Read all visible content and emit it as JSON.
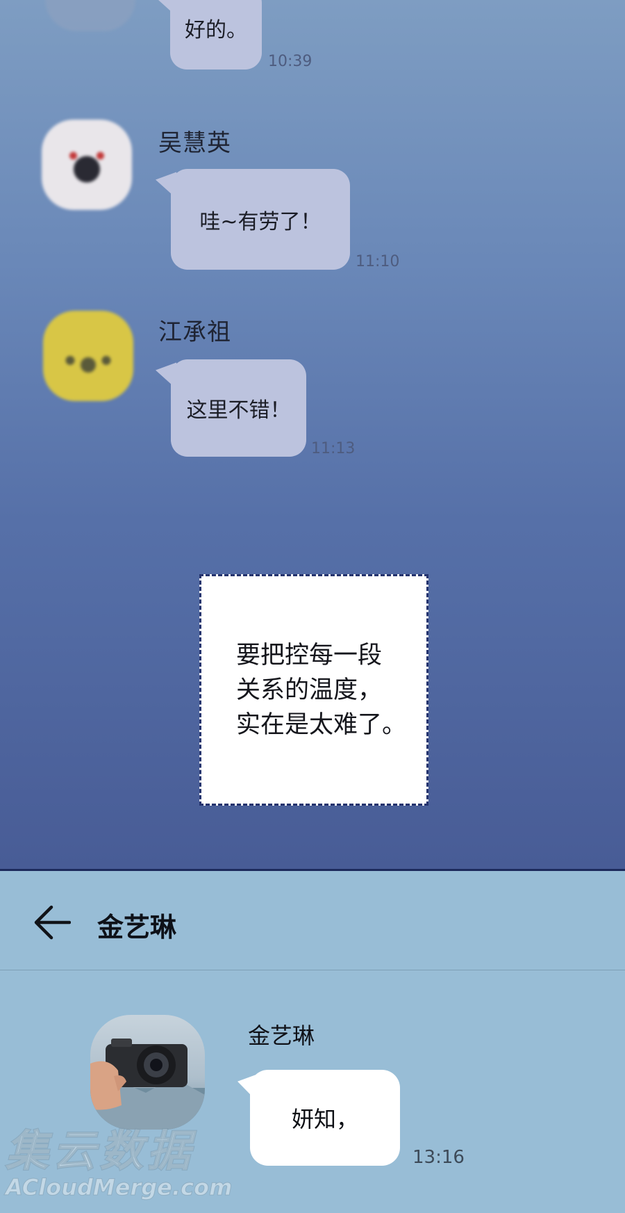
{
  "top_chat": {
    "messages": [
      {
        "sender": "",
        "text": "好的。",
        "time": "10:39"
      },
      {
        "sender": "吴慧英",
        "text": "哇~有劳了！",
        "time": "11:10"
      },
      {
        "sender": "江承祖",
        "text": "这里不错！",
        "time": "11:13"
      }
    ]
  },
  "caption": {
    "lines": [
      "要把控每一段",
      "关系的温度，",
      "实在是太难了。"
    ]
  },
  "chat": {
    "header_title": "金艺琳",
    "messages": [
      {
        "sender": "金艺琳",
        "text": "妍知，",
        "time": "13:16"
      }
    ]
  },
  "watermark": {
    "cn": "集云数据",
    "en": "ACloudMerge.com"
  },
  "icons": {
    "back": "back-arrow-icon"
  },
  "colors": {
    "top_bg": "#6a88b8",
    "bubble": "#bcc3de",
    "bottom_bg": "#98bdd6"
  }
}
